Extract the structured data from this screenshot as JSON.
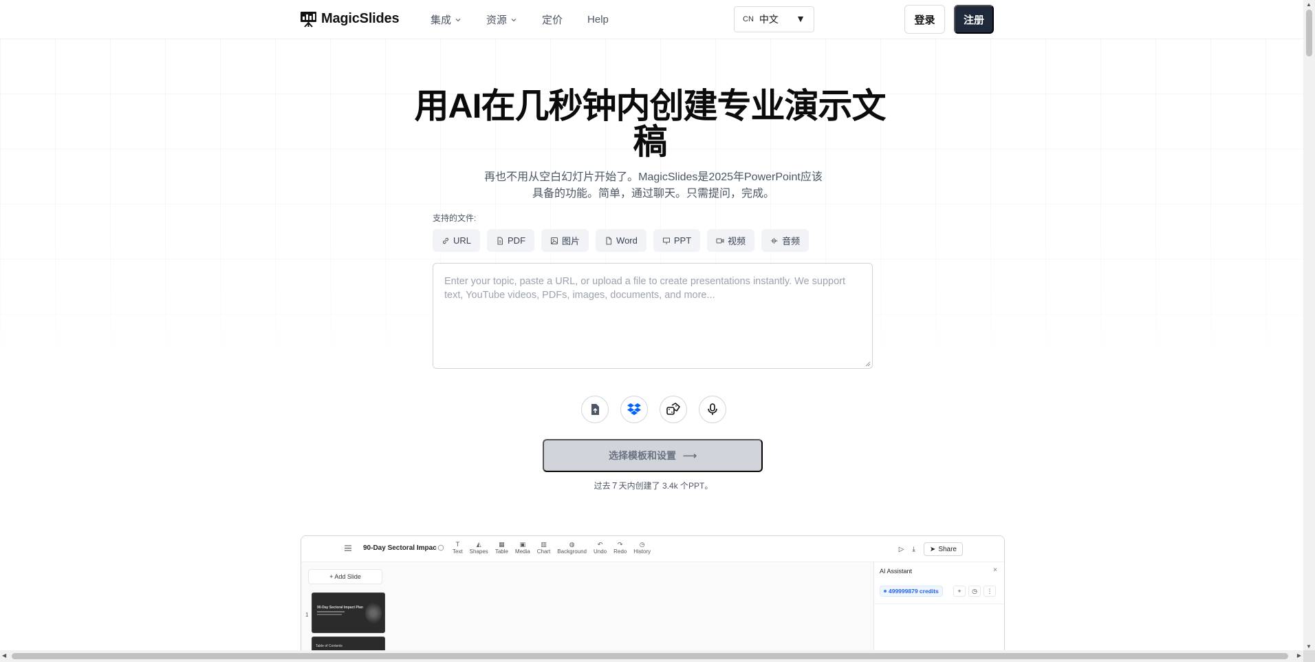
{
  "nav": {
    "brand": "MagicSlides",
    "links": [
      {
        "label": "集成",
        "dropdown": true
      },
      {
        "label": "资源",
        "dropdown": true
      },
      {
        "label": "定价",
        "dropdown": false
      },
      {
        "label": "Help",
        "dropdown": false
      }
    ],
    "language": {
      "code": "CN",
      "label": "中文",
      "arrow": "▼"
    },
    "login": "登录",
    "signup": "注册"
  },
  "hero": {
    "title_line1": "用AI在几秒钟内创建专业演示文",
    "title_line2": "稿",
    "subtitle_line1": "再也不用从空白幻灯片开始了。MagicSlides是2025年PowerPoint应该",
    "subtitle_line2": "具备的功能。简单，通过聊天。只需提问，完成。"
  },
  "upload": {
    "label": "支持的文件:",
    "chips": [
      {
        "label": "URL",
        "icon": "link-icon"
      },
      {
        "label": "PDF",
        "icon": "file-icon"
      },
      {
        "label": "图片",
        "icon": "image-icon"
      },
      {
        "label": "Word",
        "icon": "document-icon"
      },
      {
        "label": "PPT",
        "icon": "presentation-icon"
      },
      {
        "label": "视频",
        "icon": "video-icon"
      },
      {
        "label": "音频",
        "icon": "audio-icon"
      }
    ],
    "placeholder": "Enter your topic, paste a URL, or upload a file to create presentations instantly. We support text, YouTube videos, PDFs, images, documents, and more...",
    "actions": [
      "upload-file-icon",
      "dropbox-icon",
      "dice-icon",
      "microphone-icon"
    ]
  },
  "cta": {
    "label": "选择模板和设置",
    "arrow": "⟶"
  },
  "stat": "过去７天内创建了 3.4k 个PPT。",
  "editor": {
    "title": "90-Day Sectoral Impac",
    "tools": [
      {
        "label": "Text",
        "glyph": "T"
      },
      {
        "label": "Shapes",
        "glyph": "◭"
      },
      {
        "label": "Table",
        "glyph": "▦"
      },
      {
        "label": "Media",
        "glyph": "▣"
      },
      {
        "label": "Chart",
        "glyph": "▥"
      },
      {
        "label": "Background",
        "glyph": "◍"
      },
      {
        "label": "Undo",
        "glyph": "↶"
      },
      {
        "label": "Redo",
        "glyph": "↷"
      },
      {
        "label": "History",
        "glyph": "◷"
      }
    ],
    "share": "Share",
    "add_slide": "+ Add Slide",
    "slide_number": "1",
    "slide1_title": "90-Day Sectoral Impact Plan",
    "slide2_title": "Table of Contents",
    "ai_title": "AI Assistant",
    "ai_close": "×",
    "credits": "499999879 credits"
  },
  "colors": {
    "signup_bg": "#1e293b",
    "cta_bg": "#d1d5db",
    "credits_text": "#2563eb",
    "dropbox": "#0061ff"
  }
}
